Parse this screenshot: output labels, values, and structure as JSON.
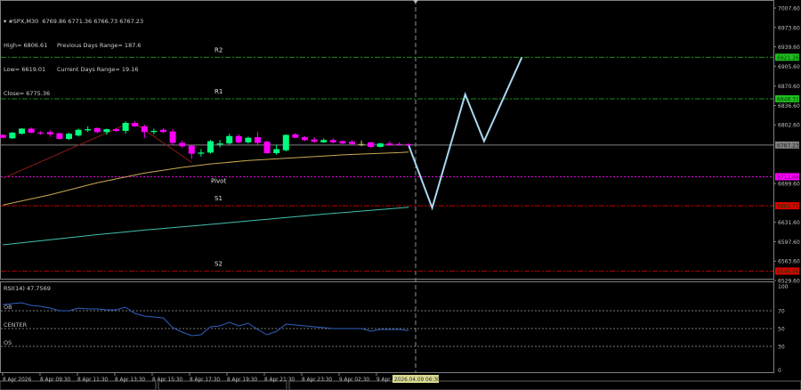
{
  "header": {
    "symbol_line": "#SPX,M30  6769.86 6771.36 6766.73 6767.23",
    "high": "High= 6806.61",
    "low": "Low= 6619.01",
    "close": "Close= 6775.36",
    "prev_range": "Previous Days Range= 187.6",
    "curr_range": "Current Days Range= 19.16"
  },
  "colors": {
    "background": "#000000",
    "bull": "#00ff7f",
    "bear": "#ff00ff",
    "doji": "#c8c864",
    "resistance": "#1fbf1f",
    "pivot": "#ff00ff",
    "support": "#e00000",
    "ma_slow": "#40c0b0",
    "ma_fast": "#c8a850",
    "zigzag": "#8b1a1a",
    "forecast": "#a8d8f0",
    "rsi": "#3060c0",
    "current_price": "#808080"
  },
  "price_axis": {
    "range": [
      6529.6,
      7007.6
    ],
    "ticks": [
      "7007.60",
      "6973.60",
      "6939.60",
      "6905.60",
      "6870.60",
      "6836.60",
      "6802.60",
      "6699.60",
      "6631.60",
      "6597.60",
      "6563.60",
      "6529.60"
    ],
    "current_price": "6767.23"
  },
  "levels": [
    {
      "name": "R2",
      "value": "6921.26",
      "type": "resistance"
    },
    {
      "name": "R1",
      "value": "6848.31",
      "type": "resistance"
    },
    {
      "name": "Pivot",
      "value": "6711.66",
      "type": "pivot"
    },
    {
      "name": "S1",
      "value": "6660.71",
      "type": "support"
    },
    {
      "name": "S2",
      "value": "6546.06",
      "type": "support"
    }
  ],
  "candles": [
    [
      6785,
      6786,
      6779,
      6780
    ],
    [
      6779,
      6790,
      6778,
      6789
    ],
    [
      6787,
      6797,
      6786,
      6796
    ],
    [
      6796,
      6798,
      6788,
      6789
    ],
    [
      6789,
      6792,
      6785,
      6788
    ],
    [
      6790,
      6793,
      6782,
      6786
    ],
    [
      6788,
      6789,
      6777,
      6778
    ],
    [
      6778,
      6789,
      6776,
      6787
    ],
    [
      6784,
      6796,
      6782,
      6794
    ],
    [
      6793,
      6800,
      6790,
      6795
    ],
    [
      6797,
      6798,
      6788,
      6790
    ],
    [
      6790,
      6796,
      6785,
      6795
    ],
    [
      6795,
      6797,
      6790,
      6792
    ],
    [
      6792,
      6809,
      6787,
      6806
    ],
    [
      6806,
      6809,
      6799,
      6800
    ],
    [
      6800,
      6803,
      6779,
      6790
    ],
    [
      6790,
      6796,
      6786,
      6792
    ],
    [
      6794,
      6797,
      6788,
      6790
    ],
    [
      6791,
      6795,
      6766,
      6771
    ],
    [
      6771,
      6775,
      6762,
      6765
    ],
    [
      6766,
      6768,
      6743,
      6752
    ],
    [
      6752,
      6760,
      6747,
      6754
    ],
    [
      6754,
      6776,
      6752,
      6774
    ],
    [
      6768,
      6776,
      6763,
      6770
    ],
    [
      6770,
      6787,
      6768,
      6783
    ],
    [
      6783,
      6786,
      6770,
      6772
    ],
    [
      6772,
      6782,
      6770,
      6780
    ],
    [
      6781,
      6790,
      6766,
      6771
    ],
    [
      6773,
      6775,
      6752,
      6753
    ],
    [
      6753,
      6768,
      6750,
      6760
    ],
    [
      6758,
      6786,
      6756,
      6785
    ],
    [
      6786,
      6788,
      6779,
      6780
    ],
    [
      6781,
      6783,
      6774,
      6776
    ],
    [
      6777,
      6781,
      6771,
      6773
    ],
    [
      6772,
      6779,
      6771,
      6776
    ],
    [
      6776,
      6779,
      6770,
      6772
    ],
    [
      6774,
      6775,
      6769,
      6770
    ],
    [
      6773,
      6776,
      6767,
      6769
    ],
    [
      6769,
      6775,
      6765,
      6769
    ],
    [
      6772,
      6773,
      6762,
      6764
    ],
    [
      6764,
      6771,
      6763,
      6770
    ],
    [
      6770,
      6774,
      6766,
      6767
    ],
    [
      6769,
      6772,
      6766,
      6768
    ],
    [
      6769,
      6770,
      6765,
      6767.23
    ]
  ],
  "ma_fast": [
    [
      0,
      6662
    ],
    [
      5,
      6680
    ],
    [
      10,
      6701
    ],
    [
      15,
      6718
    ],
    [
      19,
      6728
    ],
    [
      22,
      6734
    ],
    [
      26,
      6740
    ],
    [
      31,
      6745
    ],
    [
      36,
      6750
    ],
    [
      42,
      6754
    ],
    [
      43,
      6755
    ]
  ],
  "ma_slow": [
    [
      0,
      6592
    ],
    [
      5,
      6601
    ],
    [
      10,
      6610
    ],
    [
      15,
      6618
    ],
    [
      22,
      6628
    ],
    [
      28,
      6637
    ],
    [
      34,
      6646
    ],
    [
      40,
      6654
    ],
    [
      43,
      6658
    ]
  ],
  "zigzag": [
    [
      0,
      6709
    ],
    [
      13,
      6803
    ],
    [
      14,
      6805
    ],
    [
      20,
      6737
    ]
  ],
  "forecast": [
    [
      43,
      6767
    ],
    [
      45.5,
      6657
    ],
    [
      49,
      6856
    ],
    [
      51,
      6774
    ],
    [
      55,
      6921
    ]
  ],
  "rsi": {
    "label": "RSI(14) 47.7569",
    "levels": [
      {
        "name": "OB",
        "value": 70
      },
      {
        "name": "CENTER",
        "value": 50
      },
      {
        "name": "OS",
        "value": 30
      }
    ],
    "ticks": [
      "100",
      "70",
      "50",
      "30",
      "0"
    ],
    "values": [
      77,
      78,
      79,
      76,
      75,
      73,
      70,
      70,
      73,
      72,
      72,
      71,
      71,
      74,
      67,
      64,
      63,
      62,
      51,
      46,
      42,
      43,
      52,
      53,
      57,
      53,
      56,
      49,
      43,
      47,
      55,
      54,
      53,
      52,
      51,
      50,
      50,
      50,
      50,
      47,
      49,
      49,
      49,
      47.76
    ]
  },
  "time_axis": {
    "labels": [
      "8 Apr 2026",
      "8 Apr 09:30",
      "8 Apr 11:30",
      "8 Apr 13:30",
      "8 Apr 15:30",
      "8 Apr 17:30",
      "8 Apr 19:30",
      "8 Apr 21:30",
      "8 Apr 23:30",
      "9 Apr 02:30",
      "9 Apr"
    ],
    "cursor_label": "2026.04.09 06:30"
  }
}
